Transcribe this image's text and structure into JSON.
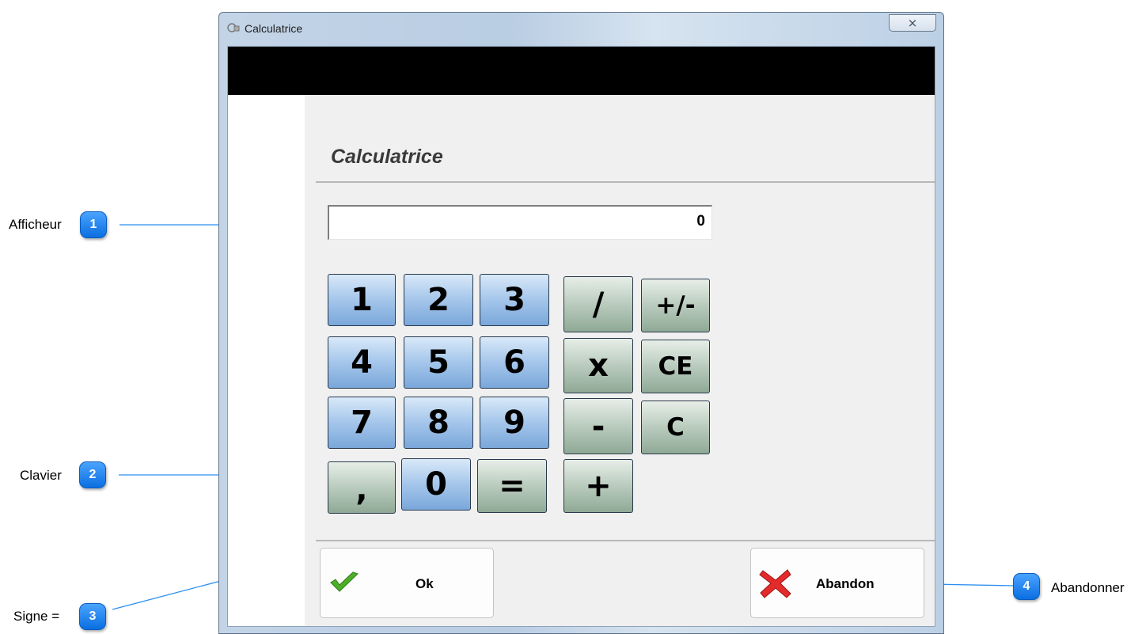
{
  "window": {
    "title": "Calculatrice",
    "close_glyph": "⨯"
  },
  "dialog": {
    "heading": "Calculatrice",
    "display_value": "0",
    "digit_keys": [
      "1",
      "2",
      "3",
      "4",
      "5",
      "6",
      "7",
      "8",
      "9",
      ",",
      "0",
      "="
    ],
    "operator_keys": [
      "/",
      "+/-",
      "x",
      "CE",
      "-",
      "C",
      "+"
    ],
    "ok_label": "Ok",
    "cancel_label": "Abandon"
  },
  "callouts": [
    {
      "number": "1",
      "label": "Afficheur"
    },
    {
      "number": "2",
      "label": "Clavier"
    },
    {
      "number": "3",
      "label": "Signe ="
    },
    {
      "number": "4",
      "label": "Abandonner"
    }
  ],
  "colors": {
    "callout": "#1a80f0",
    "leader_line": "#2b8ff0",
    "digit_key": "#7aa7da",
    "operator_key": "#8fa996",
    "ok_check": "#4caf2a",
    "cancel_cross": "#e32b2b"
  },
  "icons": {
    "app": "calculator-app-icon",
    "ok": "green-check-icon",
    "cancel": "red-cross-icon"
  }
}
